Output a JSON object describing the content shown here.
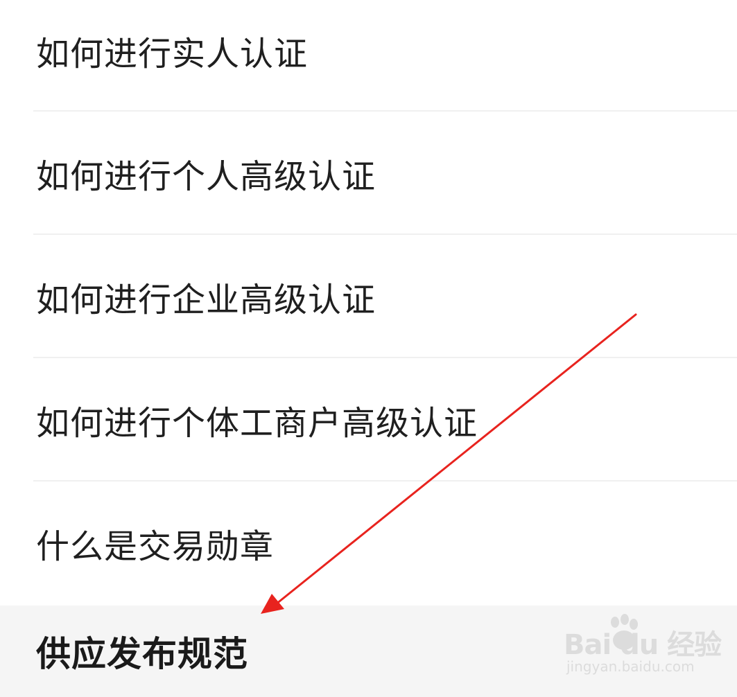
{
  "faq": {
    "items": [
      {
        "label": "如何进行实人认证"
      },
      {
        "label": "如何进行个人高级认证"
      },
      {
        "label": "如何进行企业高级认证"
      },
      {
        "label": "如何进行个体工商户高级认证"
      },
      {
        "label": "什么是交易勋章"
      }
    ]
  },
  "section": {
    "title": "供应发布规范"
  },
  "annotation": {
    "arrow_color": "#e8231e"
  },
  "watermark": {
    "brand": "Bai du 经验",
    "url": "jingyan.baidu.com"
  }
}
